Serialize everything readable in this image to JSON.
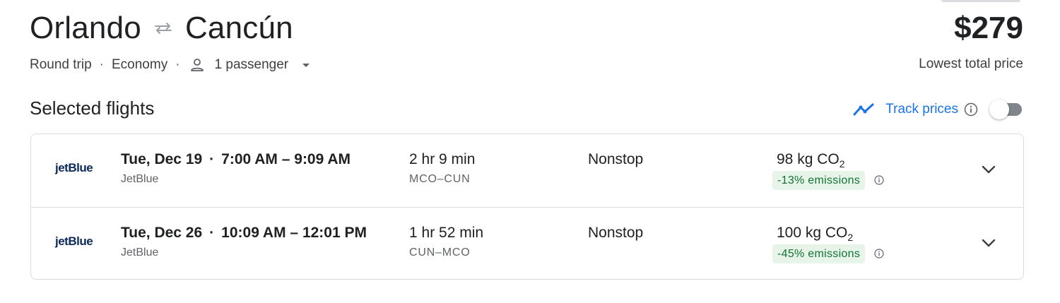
{
  "trip": {
    "origin": "Orlando",
    "destination": "Cancún",
    "trip_type": "Round trip",
    "cabin_class": "Economy",
    "passengers": "1 passenger"
  },
  "price": {
    "amount": "$279",
    "label": "Lowest total price"
  },
  "section": {
    "title": "Selected flights"
  },
  "track_prices": {
    "label": "Track prices",
    "enabled": false
  },
  "flights": [
    {
      "airline_logo": "jetBlue",
      "date": "Tue, Dec 19",
      "time_range": "7:00 AM – 9:09 AM",
      "airline": "JetBlue",
      "duration": "2 hr 9 min",
      "route": "MCO–CUN",
      "stops": "Nonstop",
      "co2_value": "98 kg CO",
      "co2_subscript": "2",
      "emissions": "-13% emissions"
    },
    {
      "airline_logo": "jetBlue",
      "date": "Tue, Dec 26",
      "time_range": "10:09 AM – 12:01 PM",
      "airline": "JetBlue",
      "duration": "1 hr 52 min",
      "route": "CUN–MCO",
      "stops": "Nonstop",
      "co2_value": "100 kg CO",
      "co2_subscript": "2",
      "emissions": "-45% emissions"
    }
  ],
  "colors": {
    "accent": "#1a73e8",
    "emissions_bg": "#e6f4ea",
    "emissions_text": "#137333",
    "logo": "#0b2a5b"
  },
  "icons": {
    "swap": "swap-arrows-icon",
    "person": "person-icon",
    "caret": "caret-down-icon",
    "trend": "trend-line-icon",
    "info": "info-icon",
    "expand": "chevron-down-icon"
  }
}
